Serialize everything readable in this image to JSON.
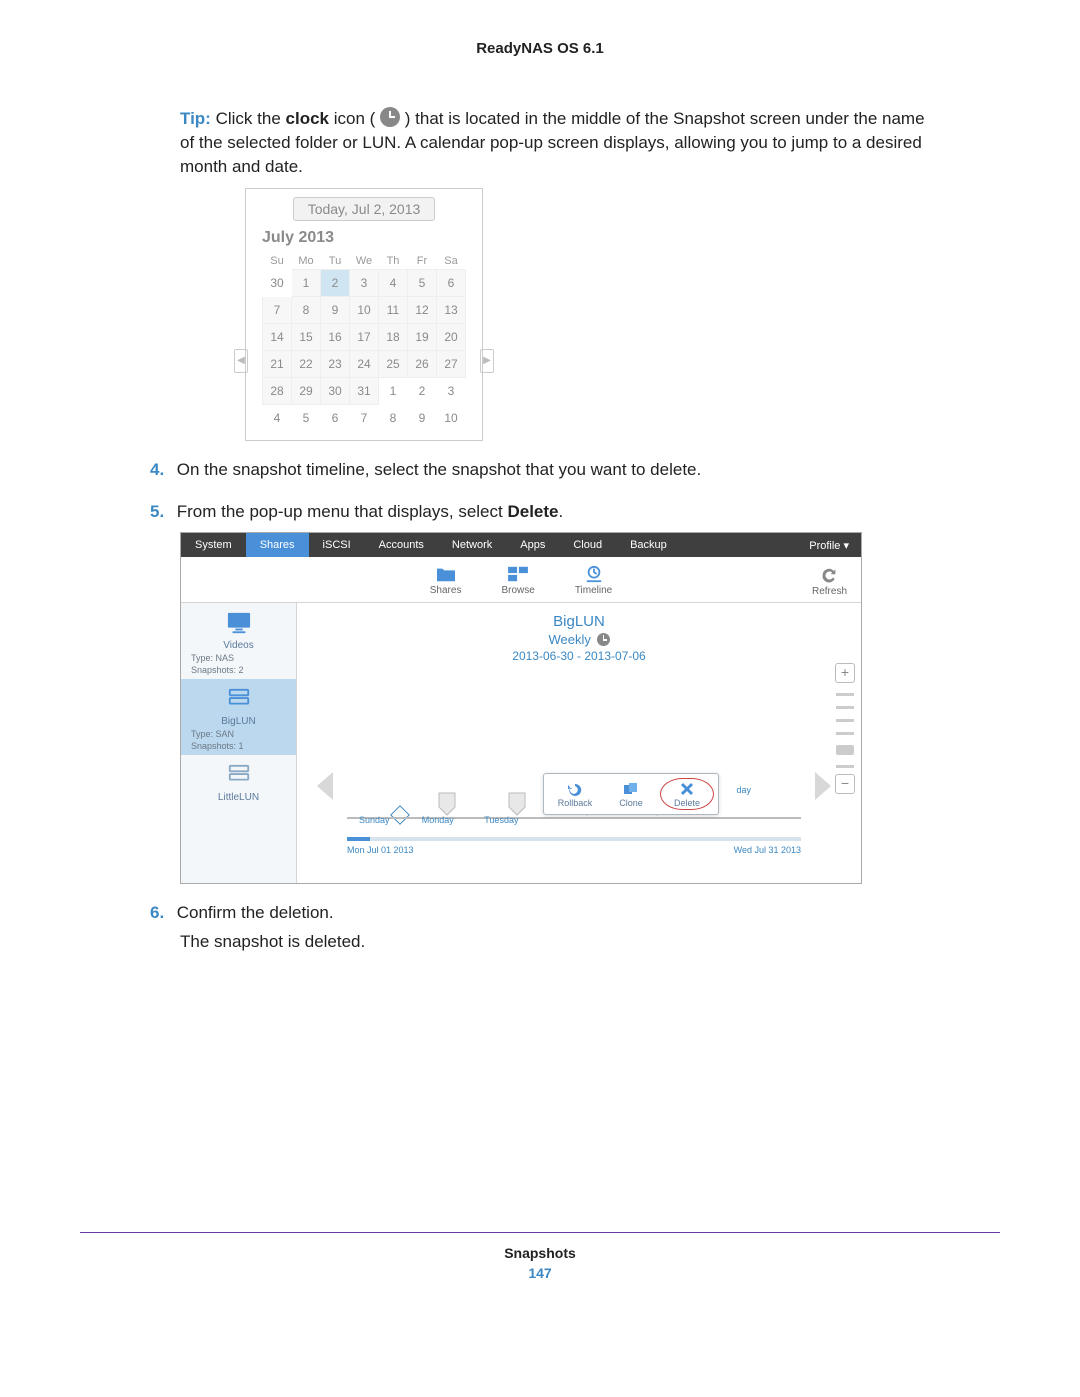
{
  "header": "ReadyNAS OS 6.1",
  "tip": {
    "label": "Tip:",
    "before": "Click the ",
    "bold1": "clock",
    "mid": " icon ( ",
    "after_icon": " ) that is located in the middle of the Snapshot screen under the name of the selected folder or LUN. A calendar pop-up screen displays, allowing you to jump to a desired month and date."
  },
  "calendar": {
    "today_btn": "Today, Jul 2, 2013",
    "month": "July 2013",
    "dow": [
      "Su",
      "Mo",
      "Tu",
      "We",
      "Th",
      "Fr",
      "Sa"
    ],
    "weeks": [
      [
        {
          "d": "30",
          "o": 1
        },
        {
          "d": "1"
        },
        {
          "d": "2",
          "sel": 1
        },
        {
          "d": "3"
        },
        {
          "d": "4"
        },
        {
          "d": "5"
        },
        {
          "d": "6"
        }
      ],
      [
        {
          "d": "7"
        },
        {
          "d": "8"
        },
        {
          "d": "9"
        },
        {
          "d": "10"
        },
        {
          "d": "11"
        },
        {
          "d": "12"
        },
        {
          "d": "13"
        }
      ],
      [
        {
          "d": "14"
        },
        {
          "d": "15"
        },
        {
          "d": "16"
        },
        {
          "d": "17"
        },
        {
          "d": "18"
        },
        {
          "d": "19"
        },
        {
          "d": "20"
        }
      ],
      [
        {
          "d": "21"
        },
        {
          "d": "22"
        },
        {
          "d": "23"
        },
        {
          "d": "24"
        },
        {
          "d": "25"
        },
        {
          "d": "26"
        },
        {
          "d": "27"
        }
      ],
      [
        {
          "d": "28"
        },
        {
          "d": "29"
        },
        {
          "d": "30"
        },
        {
          "d": "31"
        },
        {
          "d": "1",
          "o": 1
        },
        {
          "d": "2",
          "o": 1
        },
        {
          "d": "3",
          "o": 1
        }
      ],
      [
        {
          "d": "4",
          "o": 1
        },
        {
          "d": "5",
          "o": 1
        },
        {
          "d": "6",
          "o": 1
        },
        {
          "d": "7",
          "o": 1
        },
        {
          "d": "8",
          "o": 1
        },
        {
          "d": "9",
          "o": 1
        },
        {
          "d": "10",
          "o": 1
        }
      ]
    ]
  },
  "steps": {
    "n4": {
      "num": "4.",
      "text": "On the snapshot timeline, select the snapshot that you want to delete."
    },
    "n5": {
      "num": "5.",
      "text_pre": "From the pop-up menu that displays, select ",
      "bold": "Delete",
      "text_post": "."
    },
    "n6": {
      "num": "6.",
      "text": "Confirm the deletion."
    },
    "body6": "The snapshot is deleted."
  },
  "app": {
    "topnav": [
      "System",
      "Shares",
      "iSCSI",
      "Accounts",
      "Network",
      "Apps",
      "Cloud",
      "Backup"
    ],
    "topnav_active": 1,
    "profile": "Profile ▾",
    "subnav": {
      "shares": "Shares",
      "browse": "Browse",
      "timeline": "Timeline",
      "refresh": "Refresh"
    },
    "sidebar": {
      "videos": {
        "name": "Videos",
        "type": "Type:  NAS",
        "snap": "Snapshots:  2"
      },
      "biglun": {
        "name": "BigLUN",
        "type": "Type:  SAN",
        "snap": "Snapshots:  1"
      },
      "little": {
        "name": "LittleLUN"
      }
    },
    "content": {
      "title": "BigLUN",
      "sub": "Weekly",
      "dates": "2013-06-30 - 2013-07-06",
      "days": {
        "sun": "Sunday",
        "mon": "Monday",
        "tue": "Tuesday",
        "rlabel": "day"
      },
      "range_l": "Mon Jul 01 2013",
      "range_r": "Wed Jul 31 2013"
    },
    "menu": {
      "rollback": "Rollback",
      "clone": "Clone",
      "delete": "Delete"
    },
    "plus": "+",
    "minus": "−"
  },
  "footer": {
    "title": "Snapshots",
    "page": "147"
  }
}
